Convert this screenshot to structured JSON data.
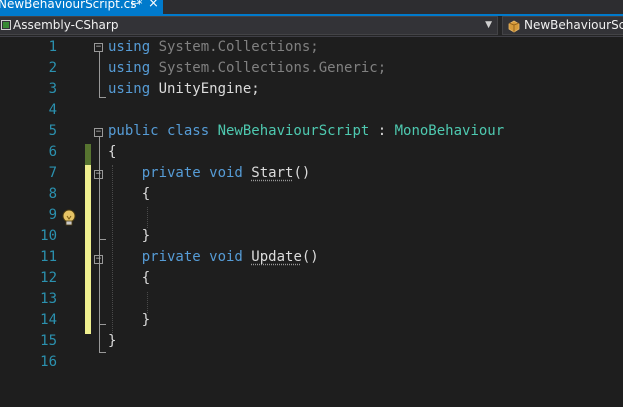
{
  "tab": {
    "title": "NewBehaviourScript.cs*",
    "pin_icon": "pin-icon",
    "close_icon": "close-icon"
  },
  "navbar": {
    "project": "Assembly-CSharp",
    "class": "NewBehaviourScript"
  },
  "editor": {
    "lines": [
      {
        "n": "1",
        "tokens": [
          {
            "t": "using ",
            "c": "kw"
          },
          {
            "t": "System.Collections;",
            "c": "dim"
          }
        ]
      },
      {
        "n": "2",
        "tokens": [
          {
            "t": "using ",
            "c": "kw"
          },
          {
            "t": "System.Collections.Generic;",
            "c": "dim"
          }
        ]
      },
      {
        "n": "3",
        "tokens": [
          {
            "t": "using ",
            "c": "kw"
          },
          {
            "t": "UnityEngine;",
            "c": "pl"
          }
        ]
      },
      {
        "n": "4",
        "tokens": []
      },
      {
        "n": "5",
        "tokens": [
          {
            "t": "public class ",
            "c": "kw"
          },
          {
            "t": "NewBehaviourScript",
            "c": "ty"
          },
          {
            "t": " : ",
            "c": "pl"
          },
          {
            "t": "MonoBehaviour",
            "c": "ty"
          }
        ]
      },
      {
        "n": "6",
        "tokens": [
          {
            "t": "{",
            "c": "pl"
          }
        ]
      },
      {
        "n": "7",
        "tokens": [
          {
            "t": "    private void ",
            "c": "kw"
          },
          {
            "t": "Start",
            "c": "fn"
          },
          {
            "t": "()",
            "c": "pl"
          }
        ]
      },
      {
        "n": "8",
        "tokens": [
          {
            "t": "    {",
            "c": "pl"
          }
        ]
      },
      {
        "n": "9",
        "tokens": []
      },
      {
        "n": "10",
        "tokens": [
          {
            "t": "    }",
            "c": "pl"
          }
        ]
      },
      {
        "n": "11",
        "tokens": [
          {
            "t": "    private void ",
            "c": "kw"
          },
          {
            "t": "Update",
            "c": "fn"
          },
          {
            "t": "()",
            "c": "pl"
          }
        ]
      },
      {
        "n": "12",
        "tokens": [
          {
            "t": "    {",
            "c": "pl"
          }
        ]
      },
      {
        "n": "13",
        "tokens": []
      },
      {
        "n": "14",
        "tokens": [
          {
            "t": "    }",
            "c": "pl"
          }
        ]
      },
      {
        "n": "15",
        "tokens": [
          {
            "t": "}",
            "c": "pl"
          }
        ]
      },
      {
        "n": "16",
        "tokens": []
      }
    ],
    "lightbulb_icon": "lightbulb-icon"
  },
  "colors": {
    "background": "#1e1e1e",
    "accent": "#007acc",
    "keyword": "#569cd6",
    "type": "#4ec9b0",
    "line_number": "#2b91af",
    "unsaved_change": "#efef8f",
    "saved_change": "#577430"
  }
}
